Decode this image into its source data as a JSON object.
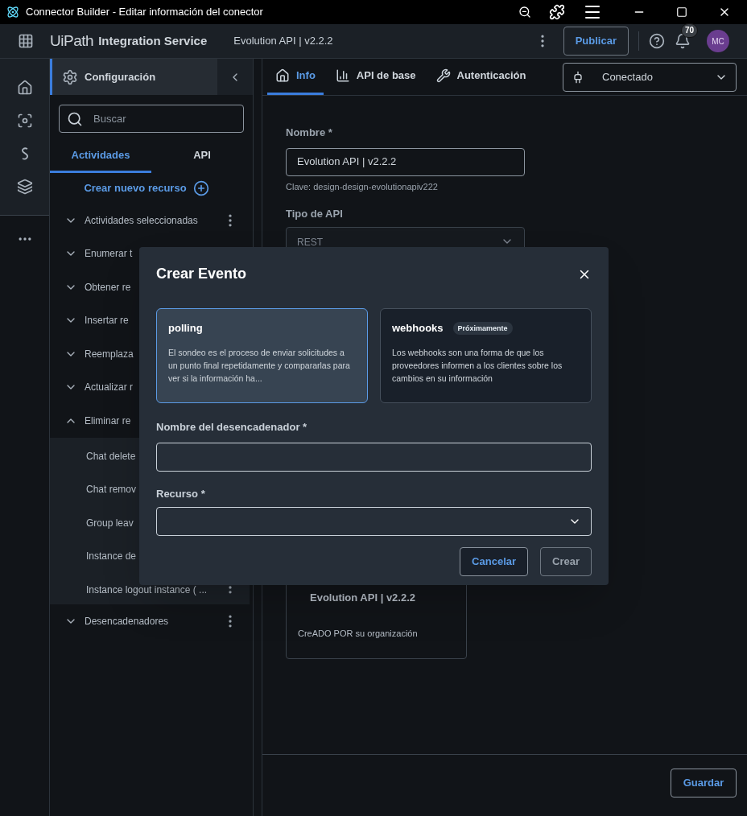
{
  "window": {
    "title": "Connector Builder - Editar información del conector"
  },
  "top_bar": {
    "logo": "UiPath",
    "product": "Integration Service",
    "connector": "Evolution API | v2.2.2",
    "publish_button": "Publicar",
    "notifications": "70",
    "avatar": "MC"
  },
  "sidebar": {
    "header": "Configuración",
    "search": {
      "placeholder": "Buscar"
    },
    "tabs": [
      {
        "label": "Actividades",
        "selected": true
      },
      {
        "label": "API",
        "selected": false
      }
    ],
    "create_link": "Crear nuevo recurso",
    "items": [
      {
        "label": "Actividades seleccionadas",
        "expanded": false,
        "menu": true
      },
      {
        "label": "Enumerar t",
        "expanded": false
      },
      {
        "label": "Obtener re",
        "expanded": false
      },
      {
        "label": "Insertar re",
        "expanded": false
      },
      {
        "label": "Reemplaza",
        "expanded": false
      },
      {
        "label": "Actualizar r",
        "expanded": false
      },
      {
        "label": "Eliminar re",
        "expanded": true,
        "children": [
          {
            "label": "Chat delete"
          },
          {
            "label": "Chat remov"
          },
          {
            "label": "Group leav"
          },
          {
            "label": "Instance de"
          },
          {
            "label": "Instance logout instance ( ...",
            "menu": true
          }
        ]
      },
      {
        "label": "Desencadenadores",
        "expanded": false,
        "menu": true
      }
    ]
  },
  "main": {
    "tabs": [
      {
        "label": "Info",
        "selected": true
      },
      {
        "label": "API de base",
        "selected": false
      },
      {
        "label": "Autenticación",
        "selected": false
      }
    ],
    "connection": "Conectado",
    "name_label": "Nombre *",
    "name_value": "Evolution API | v2.2.2",
    "key_hint": "Clave: design-design-evolutionapiv222",
    "api_type_label": "Tipo de API",
    "api_type_value": "REST",
    "card": {
      "title": "Evolution API | v2.2.2",
      "subtitle": "CreADO POR su organización"
    },
    "save_button": "Guardar"
  },
  "dialog": {
    "title": "Crear Evento",
    "options": [
      {
        "title": "polling",
        "selected": true,
        "description": "El sondeo es el proceso de enviar solicitudes a un punto final repetidamente y compararlas para ver si la información ha..."
      },
      {
        "title": "webhooks",
        "badge": "Próximamente",
        "selected": false,
        "description": "Los webhooks son una forma de que los proveedores informen a los clientes sobre los cambios en su información"
      }
    ],
    "trigger_label": "Nombre del desencadenador *",
    "resource_label": "Recurso *",
    "buttons": [
      "Cancelar",
      "Crear"
    ]
  }
}
